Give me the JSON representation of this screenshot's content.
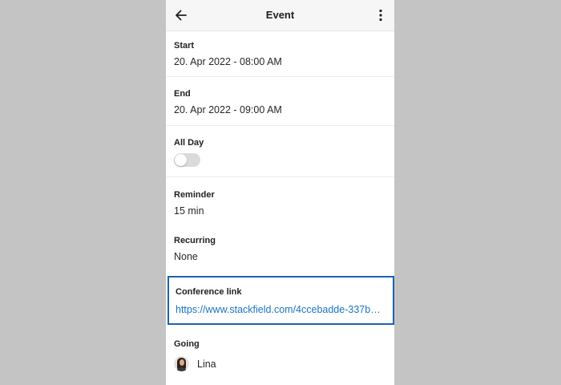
{
  "header": {
    "title": "Event",
    "back_icon": "arrow-left-icon",
    "menu_icon": "more-vertical-icon"
  },
  "fields": {
    "start": {
      "label": "Start",
      "value": "20. Apr 2022 - 08:00 AM"
    },
    "end": {
      "label": "End",
      "value": "20. Apr 2022 - 09:00 AM"
    },
    "all_day": {
      "label": "All Day",
      "enabled": false
    },
    "reminder": {
      "label": "Reminder",
      "value": "15 min"
    },
    "recurring": {
      "label": "Recurring",
      "value": "None"
    },
    "conference": {
      "label": "Conference link",
      "value": "https://www.stackfield.com/4ccebadde-337b802..."
    },
    "going": {
      "label": "Going",
      "attendees": [
        {
          "name": "Lina"
        }
      ]
    }
  },
  "colors": {
    "link": "#1a74c6",
    "focus_border": "#1c63b0",
    "backdrop": "#c4c4c4"
  }
}
